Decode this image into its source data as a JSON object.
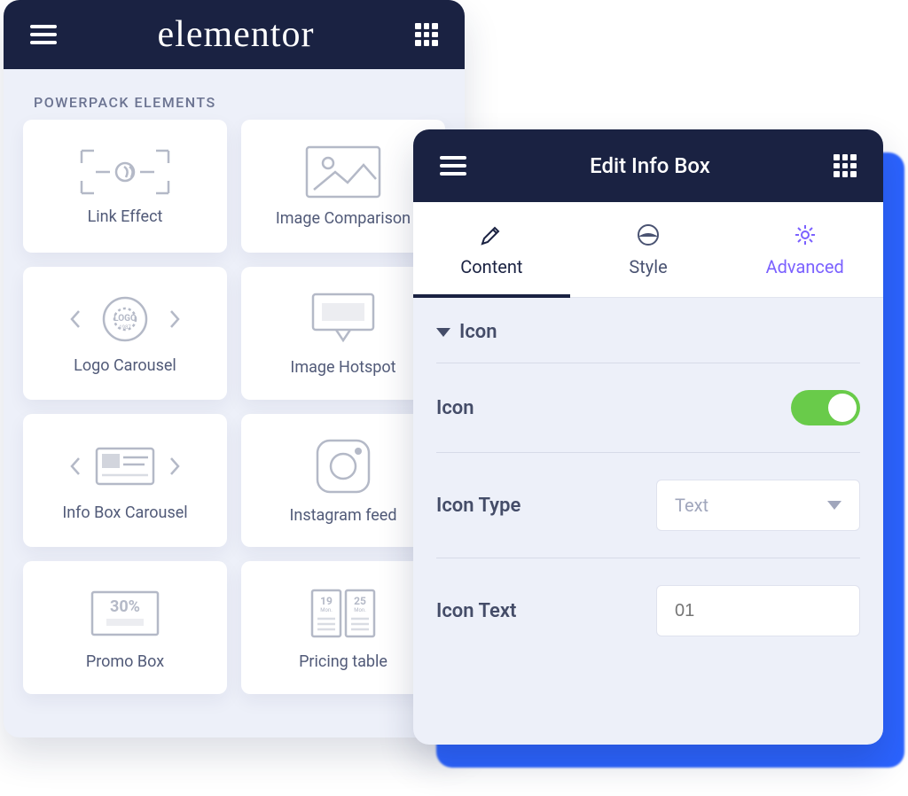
{
  "widgets_panel": {
    "brand": "elementor",
    "section_title": "POWERPACK ELEMENTS",
    "items": [
      {
        "label": "Link Effect"
      },
      {
        "label": "Image Comparison"
      },
      {
        "label": "Logo Carousel"
      },
      {
        "label": "Image Hotspot"
      },
      {
        "label": "Info Box Carousel"
      },
      {
        "label": "Instagram feed"
      },
      {
        "label": "Promo Box"
      },
      {
        "label": "Pricing table"
      }
    ]
  },
  "edit_panel": {
    "title": "Edit Info Box",
    "tabs": {
      "content": "Content",
      "style": "Style",
      "advanced": "Advanced"
    },
    "section_label": "Icon",
    "controls": {
      "icon_label": "Icon",
      "icon_on": true,
      "icon_type_label": "Icon Type",
      "icon_type_value": "Text",
      "icon_text_label": "Icon Text",
      "icon_text_placeholder": "01"
    }
  }
}
